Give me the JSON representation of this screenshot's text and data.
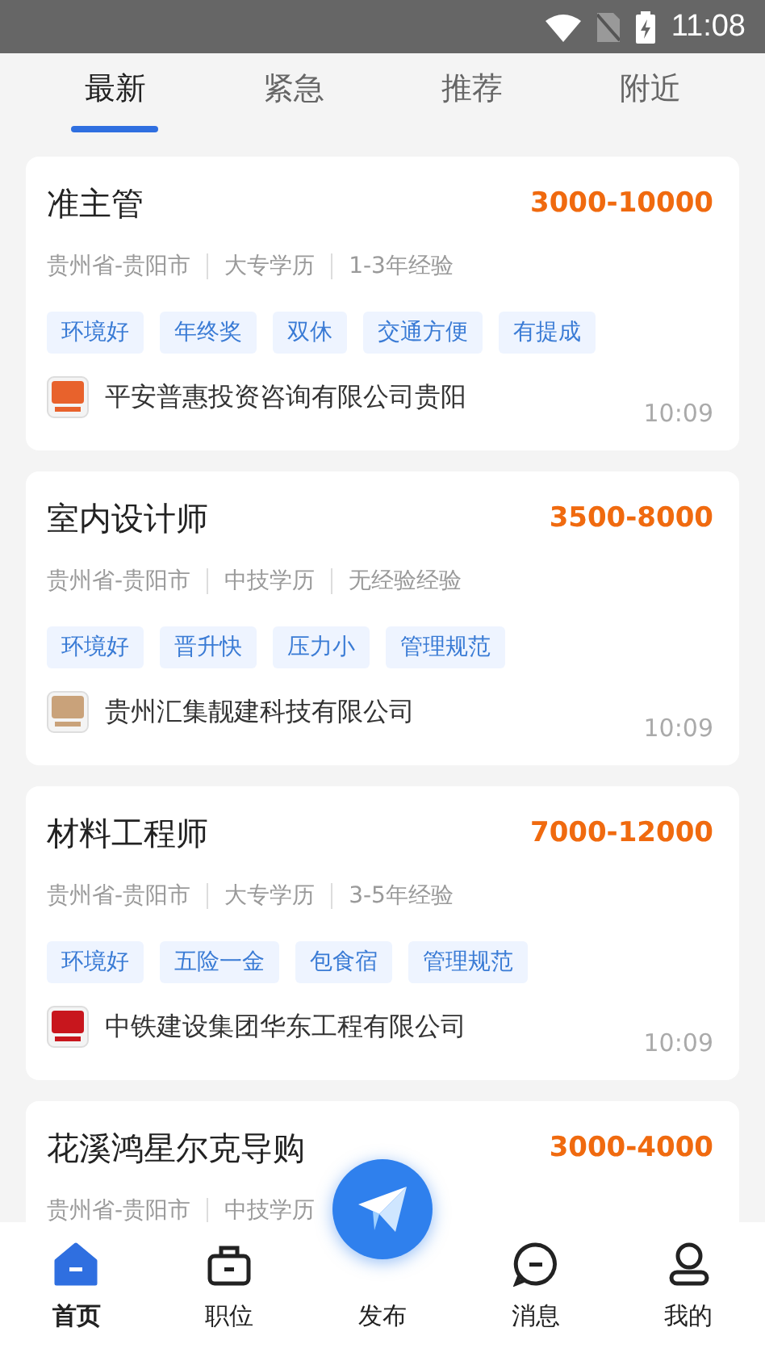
{
  "status_bar": {
    "time": "11:08"
  },
  "tabs": [
    {
      "label": "最新",
      "selected": true
    },
    {
      "label": "紧急",
      "selected": false
    },
    {
      "label": "推荐",
      "selected": false
    },
    {
      "label": "附近",
      "selected": false
    }
  ],
  "jobs": [
    {
      "title": "准主管",
      "salary": "3000-10000",
      "meta": [
        "贵州省-贵阳市",
        "大专学历",
        "1-3年经验"
      ],
      "tags": [
        "环境好",
        "年终奖",
        "双休",
        "交通方便",
        "有提成"
      ],
      "company": "平安普惠投资咨询有限公司贵阳",
      "color": "#e8622c",
      "time": "10:09"
    },
    {
      "title": "室内设计师",
      "salary": "3500-8000",
      "meta": [
        "贵州省-贵阳市",
        "中技学历",
        "无经验经验"
      ],
      "tags": [
        "环境好",
        "晋升快",
        "压力小",
        "管理规范"
      ],
      "company": "贵州汇集靓建科技有限公司",
      "color": "#c9a27a",
      "time": "10:09"
    },
    {
      "title": "材料工程师",
      "salary": "7000-12000",
      "meta": [
        "贵州省-贵阳市",
        "大专学历",
        "3-5年经验"
      ],
      "tags": [
        "环境好",
        "五险一金",
        "包食宿",
        "管理规范"
      ],
      "company": "中铁建设集团华东工程有限公司",
      "color": "#c8161d",
      "time": "10:09"
    },
    {
      "title": "花溪鸿星尔克导购",
      "salary": "3000-4000",
      "meta": [
        "贵州省-贵阳市",
        "中技学历"
      ]
    }
  ],
  "bottom_nav": [
    {
      "label": "首页",
      "kind": "home",
      "selected": true
    },
    {
      "label": "职位",
      "kind": "jobs",
      "selected": false
    },
    {
      "label": "发布",
      "kind": "publish",
      "selected": false
    },
    {
      "label": "消息",
      "kind": "messages",
      "selected": false
    },
    {
      "label": "我的",
      "kind": "profile",
      "selected": false
    }
  ]
}
